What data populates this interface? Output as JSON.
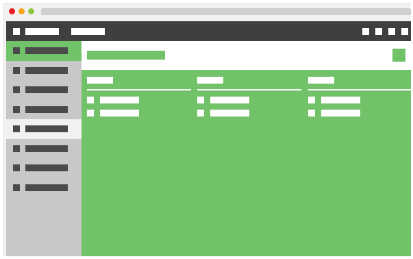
{
  "colors": {
    "accent_green": "#72c26a",
    "dark_bar": "#3f3f3f",
    "sidebar_bg": "#c8c8c8",
    "placeholder_dark": "#4a4a4a",
    "selected_item_bg": "#f1f1f1",
    "traffic_red": "#ec1c24",
    "traffic_yellow": "#f7a51c",
    "traffic_green": "#8cc63f"
  },
  "chrome": {
    "traffic_lights": [
      "close-dot",
      "minimize-dot",
      "maximize-dot"
    ]
  },
  "topbar": {
    "nav_items": [
      "nav-item-1",
      "nav-item-2"
    ],
    "action_icons": [
      "action-icon-1",
      "action-icon-2",
      "action-icon-3",
      "action-icon-4"
    ]
  },
  "sidebar": {
    "items": [
      {
        "id": "item-1",
        "state": "active"
      },
      {
        "id": "item-2",
        "state": "normal"
      },
      {
        "id": "item-3",
        "state": "normal"
      },
      {
        "id": "item-4",
        "state": "normal"
      },
      {
        "id": "item-5",
        "state": "selected"
      },
      {
        "id": "item-6",
        "state": "normal"
      },
      {
        "id": "item-7",
        "state": "normal"
      },
      {
        "id": "item-8",
        "state": "normal"
      }
    ]
  },
  "content": {
    "columns": [
      {
        "id": "column-1",
        "rows": 2
      },
      {
        "id": "column-2",
        "rows": 2
      },
      {
        "id": "column-3",
        "rows": 2
      }
    ]
  }
}
